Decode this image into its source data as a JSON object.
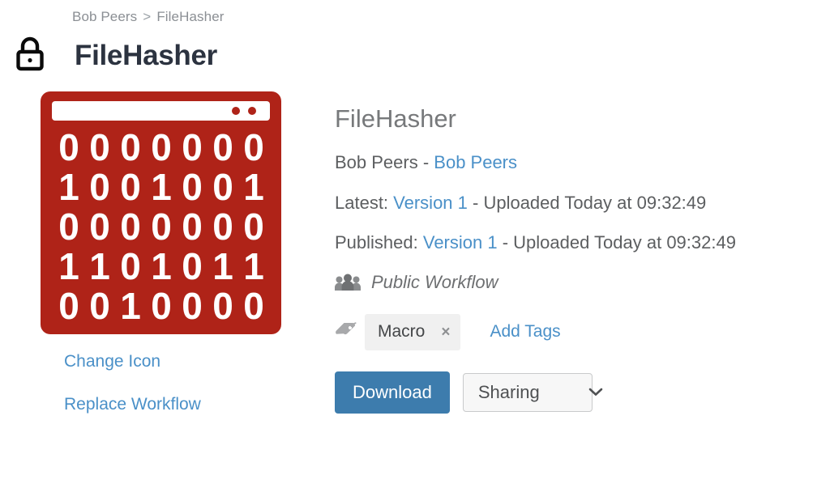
{
  "breadcrumb": {
    "items": [
      "Bob Peers",
      "FileHasher"
    ],
    "separator": ">"
  },
  "header": {
    "lock_icon": "lock-icon",
    "title": "FileHasher"
  },
  "workflow_icon": {
    "name": "binary-window-icon",
    "background_color": "#af2318",
    "foreground_color": "#ffffff",
    "binary_rows": [
      "0000000",
      "1001001",
      "0000000",
      "1101011",
      "0010000"
    ],
    "titlebar_dots": 2
  },
  "left_links": [
    {
      "label": "Change Icon",
      "name": "change-icon-link"
    },
    {
      "label": "Replace Workflow",
      "name": "replace-workflow-link"
    }
  ],
  "details": {
    "workflow_name": "FileHasher",
    "owner_prefix": "Bob Peers - ",
    "owner_link": "Bob Peers",
    "latest": {
      "label": "Latest: ",
      "version_link": "Version 1",
      "suffix": " - Uploaded Today at 09:32:49"
    },
    "published": {
      "label": "Published: ",
      "version_link": "Version 1",
      "suffix": " - Uploaded Today at 09:32:49"
    },
    "visibility": {
      "icon": "people-group-icon",
      "label": "Public Workflow"
    }
  },
  "tags": {
    "icon": "tag-icon",
    "chips": [
      {
        "label": "Macro",
        "remove": "×"
      }
    ],
    "add_label": "Add Tags"
  },
  "actions": {
    "download_label": "Download",
    "sharing_label": "Sharing",
    "chevron_icon": "chevron-down-icon"
  },
  "colors": {
    "accent_blue": "#4a90c8",
    "button_blue": "#3d7cad",
    "icon_red": "#af2318",
    "title_dark": "#2c3340"
  }
}
